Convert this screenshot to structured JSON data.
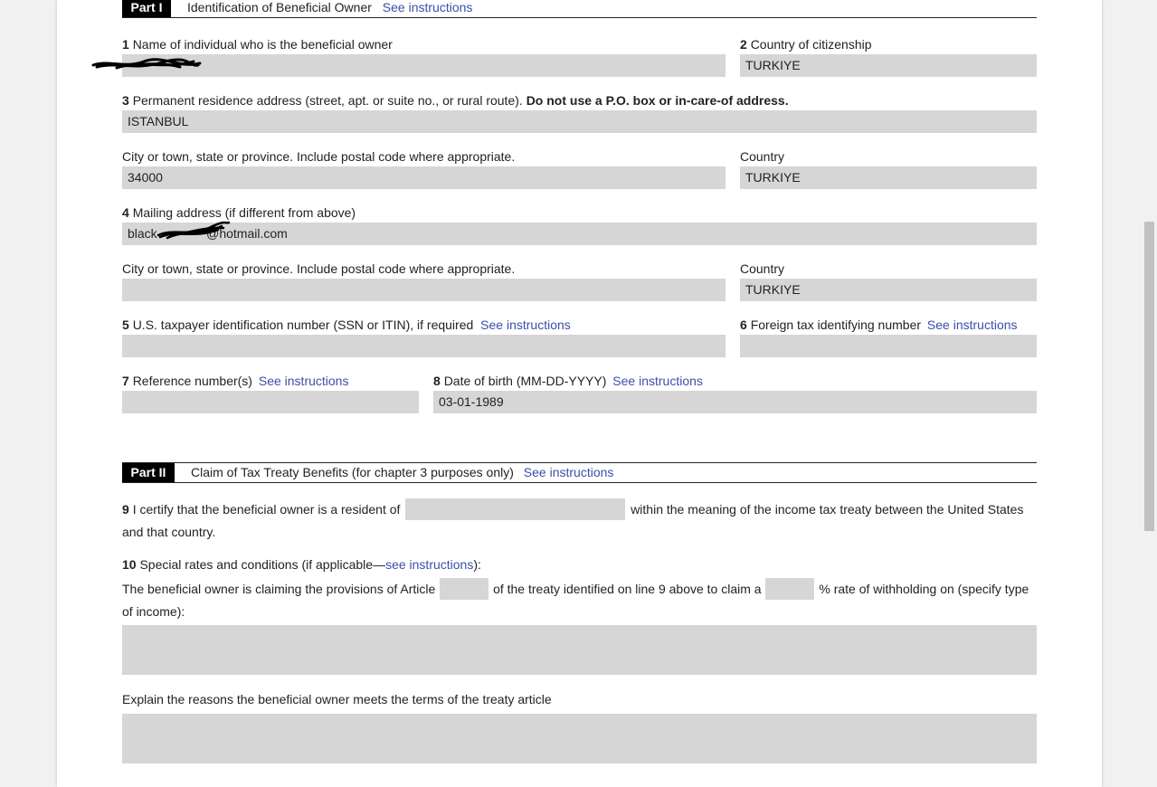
{
  "part1": {
    "badge": "Part I",
    "title": "Identification of Beneficial Owner",
    "link": "See instructions"
  },
  "line1": {
    "num": "1",
    "label": "Name of individual who is the beneficial owner",
    "value": ""
  },
  "line2": {
    "num": "2",
    "label": "Country of citizenship",
    "value": "TURKIYE"
  },
  "line3": {
    "num": "3",
    "label": "Permanent residence address (street, apt. or suite no., or rural route).",
    "bold_label": "Do not use a P.O. box or in-care-of address.",
    "value": "ISTANBUL"
  },
  "line3_city": {
    "label": "City or town, state or province. Include postal code where appropriate.",
    "value": "34000"
  },
  "line3_country": {
    "label": "Country",
    "value": "TURKIYE"
  },
  "line4": {
    "num": "4",
    "label": "Mailing address (if different from above)",
    "value": "black              @hotmail.com"
  },
  "line4_city": {
    "label": "City or town, state or province. Include postal code where appropriate.",
    "value": ""
  },
  "line4_country": {
    "label": "Country",
    "value": "TURKIYE"
  },
  "line5": {
    "num": "5",
    "label": "U.S. taxpayer identification number (SSN or ITIN), if required",
    "link": "See instructions",
    "value": ""
  },
  "line6": {
    "num": "6",
    "label": "Foreign tax identifying number",
    "link": "See instructions",
    "value": ""
  },
  "line7": {
    "num": "7",
    "label": "Reference number(s)",
    "link": "See instructions",
    "value": ""
  },
  "line8": {
    "num": "8",
    "label": "Date of birth (MM-DD-YYYY)",
    "link": "See instructions",
    "value": "03-01-1989"
  },
  "part2": {
    "badge": "Part II",
    "title": "Claim of Tax Treaty Benefits (for chapter 3 purposes only)",
    "link": "See instructions"
  },
  "line9": {
    "num": "9",
    "text_before": "I certify that the beneficial owner is a resident of",
    "text_after": "within the meaning of the income tax treaty between the United States",
    "text_line2": "and that country."
  },
  "line10": {
    "num": "10",
    "label": "Special rates and conditions (if applicable—",
    "link": "see instructions",
    "label_end": "):",
    "text_a": "The beneficial owner is claiming the provisions of Article",
    "text_b": "of the treaty identified on line 9 above to claim a",
    "text_c": "% rate of withholding on (specify type",
    "text_line2": "of income):"
  },
  "explain": {
    "label": "Explain the reasons the beneficial owner meets the terms of the treaty article"
  }
}
